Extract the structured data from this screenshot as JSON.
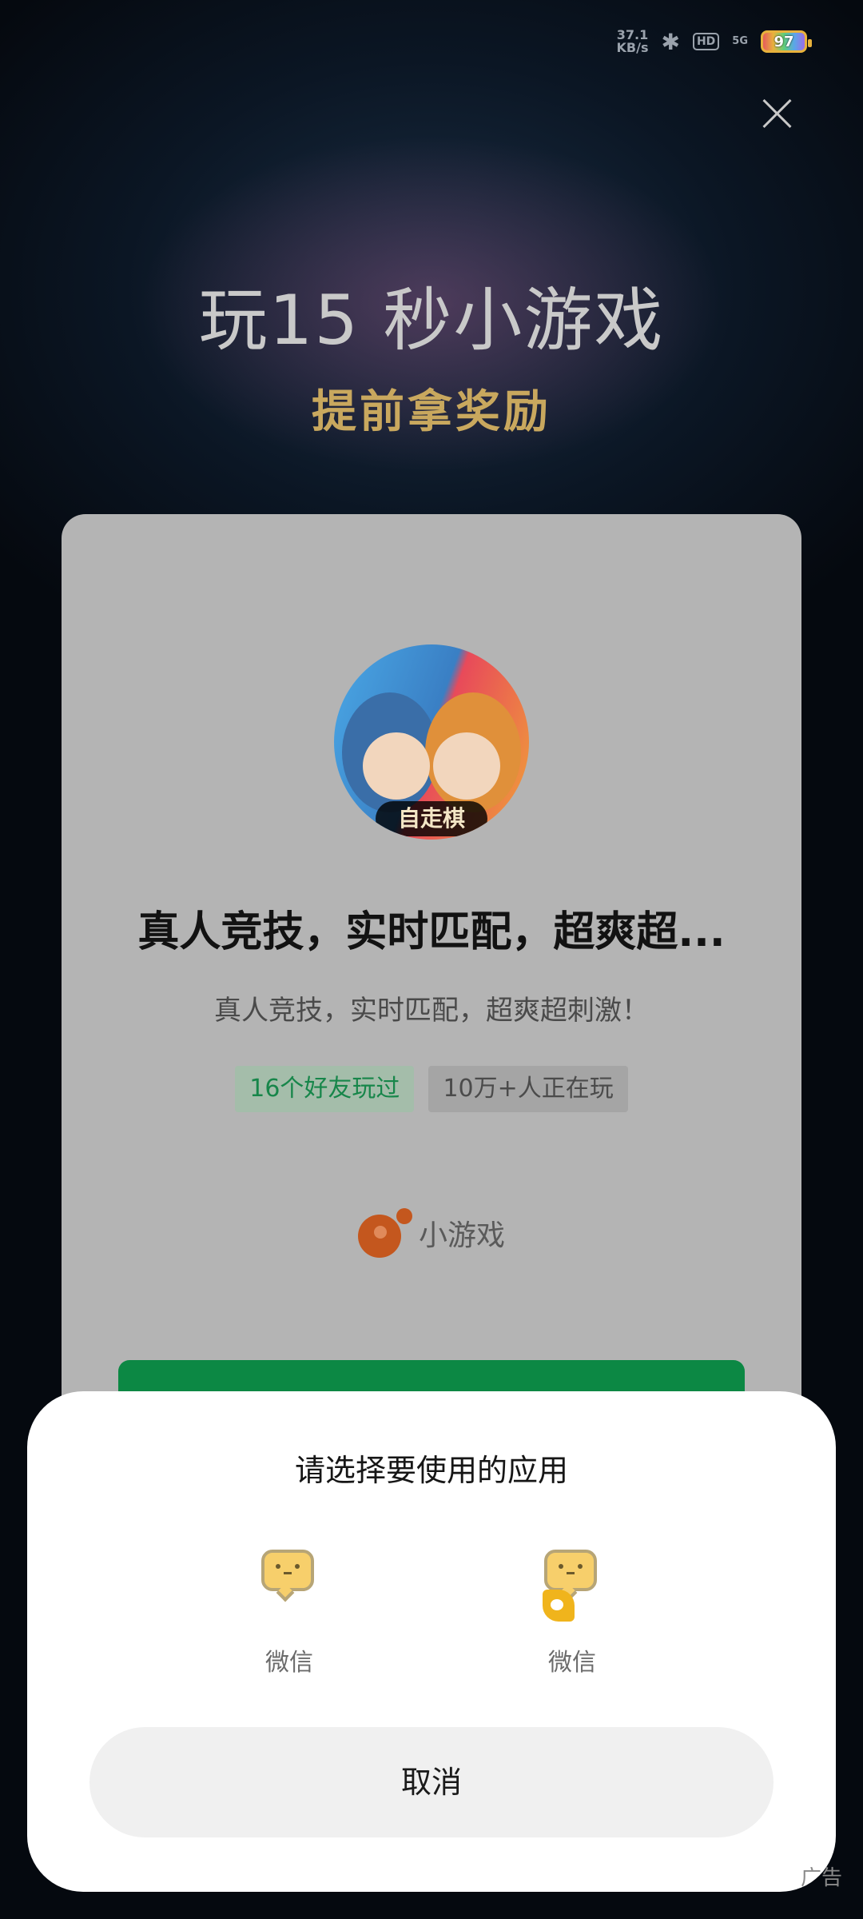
{
  "status_bar": {
    "speed_value": "37.1",
    "speed_unit": "KB/s",
    "hd_label": "HD",
    "network": "5G",
    "battery": "97"
  },
  "header": {
    "title": "玩15 秒小游戏",
    "subtitle": "提前拿奖励"
  },
  "card": {
    "game_icon_label": "自走棋",
    "title": "真人竞技，实时匹配，超爽超...",
    "description": "真人竞技，实时匹配，超爽超刺激！",
    "tags": [
      "16个好友玩过",
      "10万+人正在玩"
    ],
    "brand": "小游戏"
  },
  "sheet": {
    "title": "请选择要使用的应用",
    "apps": [
      {
        "label": "微信",
        "icon": "wechat-icon"
      },
      {
        "label": "微信",
        "icon": "wechat-clone-icon"
      }
    ],
    "cancel_label": "取消"
  },
  "ad_label": "广告"
}
